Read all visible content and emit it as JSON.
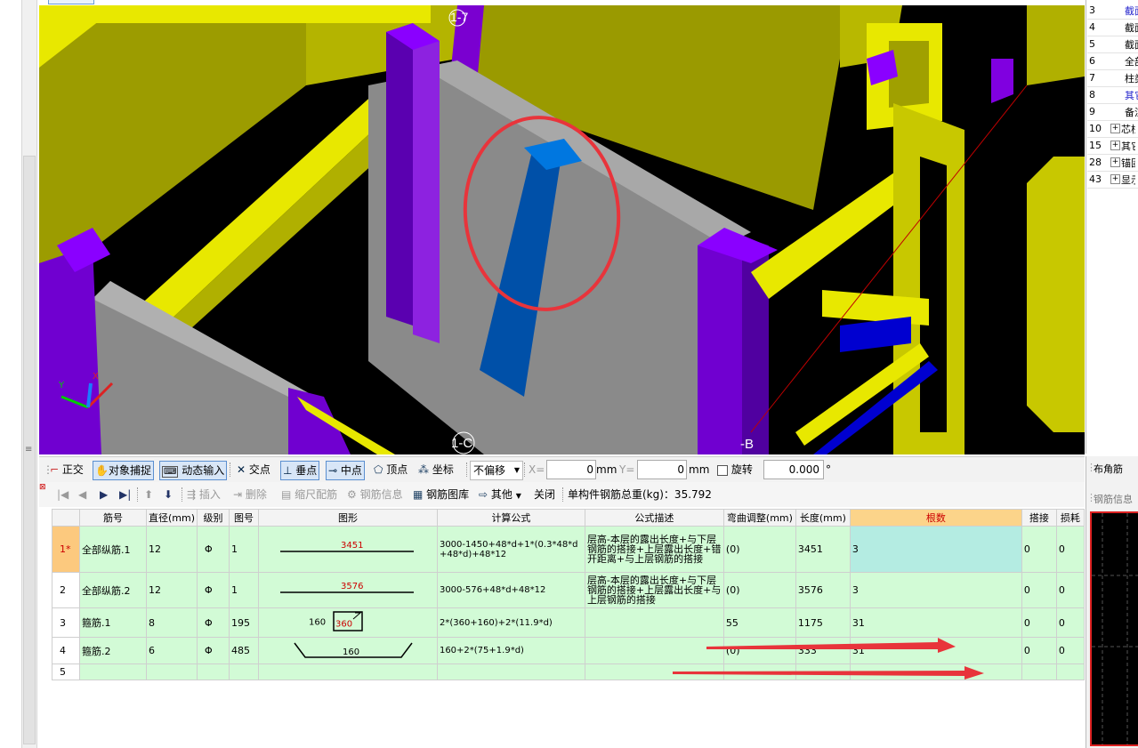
{
  "viewport": {
    "axis_labels": [
      "1-7",
      "1-C",
      "-B"
    ],
    "axis_gizmo": {
      "x": "X",
      "y": "Y"
    }
  },
  "right_panel": {
    "rows": [
      {
        "num": "3",
        "text": "截面",
        "expand": false,
        "highlight": true
      },
      {
        "num": "4",
        "text": "截面",
        "expand": false,
        "highlight": false
      },
      {
        "num": "5",
        "text": "截面",
        "expand": false,
        "highlight": false
      },
      {
        "num": "6",
        "text": "全部",
        "expand": false,
        "highlight": false
      },
      {
        "num": "7",
        "text": "柱类",
        "expand": false,
        "highlight": false
      },
      {
        "num": "8",
        "text": "其它",
        "expand": false,
        "highlight": true
      },
      {
        "num": "9",
        "text": "备注",
        "expand": false,
        "highlight": false
      },
      {
        "num": "10",
        "text": "芯柱",
        "expand": true,
        "highlight": false
      },
      {
        "num": "15",
        "text": "其它",
        "expand": true,
        "highlight": false
      },
      {
        "num": "28",
        "text": "锚固",
        "expand": true,
        "highlight": false
      },
      {
        "num": "43",
        "text": "显示",
        "expand": true,
        "highlight": false
      }
    ],
    "tab_label": "布角筋",
    "info_label": "钢筋信息"
  },
  "snap_toolbar": {
    "ortho": "正交",
    "object_snap": "对象捕捉",
    "dynamic_input": "动态输入",
    "intersection": "交点",
    "perpendicular": "垂点",
    "midpoint": "中点",
    "vertex": "顶点",
    "coordinate": "坐标",
    "offset_mode": "不偏移",
    "x_label": "X=",
    "x_value": "0",
    "y_label": "Y=",
    "y_value": "0",
    "unit": "mm",
    "rotate_label": "旋转",
    "rotate_value": "0.000",
    "degree": "°"
  },
  "grid_toolbar": {
    "insert": "插入",
    "delete": "删除",
    "scale_rebar": "缩尺配筋",
    "rebar_info": "钢筋信息",
    "rebar_library": "钢筋图库",
    "other": "其他",
    "close": "关闭",
    "total_weight": "单构件钢筋总重(kg)：35.792"
  },
  "grid": {
    "columns": [
      "筋号",
      "直径(mm)",
      "级别",
      "图号",
      "图形",
      "计算公式",
      "公式描述",
      "弯曲调整(mm)",
      "长度(mm)",
      "根数",
      "搭接",
      "损耗"
    ],
    "rows": [
      {
        "row": "1*",
        "name": "全部纵筋.1",
        "diameter": "12",
        "grade": "Φ",
        "shape_no": "1",
        "shape_value": "3451",
        "formula": "3000-1450+48*d+1*(0.3*48*d+48*d)+48*12",
        "description": "层高-本层的露出长度+与下层钢筋的搭接+上层露出长度+错开距离+与上层钢筋的搭接",
        "bend": "(0)",
        "length": "3451",
        "count": "3",
        "lap": "0",
        "loss": "0"
      },
      {
        "row": "2",
        "name": "全部纵筋.2",
        "diameter": "12",
        "grade": "Φ",
        "shape_no": "1",
        "shape_value": "3576",
        "formula": "3000-576+48*d+48*12",
        "description": "层高-本层的露出长度+与下层钢筋的搭接+上层露出长度+与上层钢筋的搭接",
        "bend": "(0)",
        "length": "3576",
        "count": "3",
        "lap": "0",
        "loss": "0"
      },
      {
        "row": "3",
        "name": "箍筋.1",
        "diameter": "8",
        "grade": "Φ",
        "shape_no": "195",
        "shape_value": "160",
        "shape_value2": "360",
        "formula": "2*(360+160)+2*(11.9*d)",
        "description": "",
        "bend": "55",
        "length": "1175",
        "count": "31",
        "lap": "0",
        "loss": "0"
      },
      {
        "row": "4",
        "name": "箍筋.2",
        "diameter": "6",
        "grade": "Φ",
        "shape_no": "485",
        "shape_value": "160",
        "formula": "160+2*(75+1.9*d)",
        "description": "",
        "bend": "(0)",
        "length": "333",
        "count": "31",
        "lap": "0",
        "loss": "0"
      },
      {
        "row": "5",
        "name": "",
        "diameter": "",
        "grade": "",
        "shape_no": "",
        "shape_value": "",
        "formula": "",
        "description": "",
        "bend": "",
        "length": "",
        "count": "",
        "lap": "",
        "loss": ""
      }
    ]
  },
  "colors": {
    "grid_row_bg": "#d2fbd6",
    "active_cell": "#b4ece2",
    "annotation_red": "#e8343b",
    "viewport_bg": "#000000"
  }
}
